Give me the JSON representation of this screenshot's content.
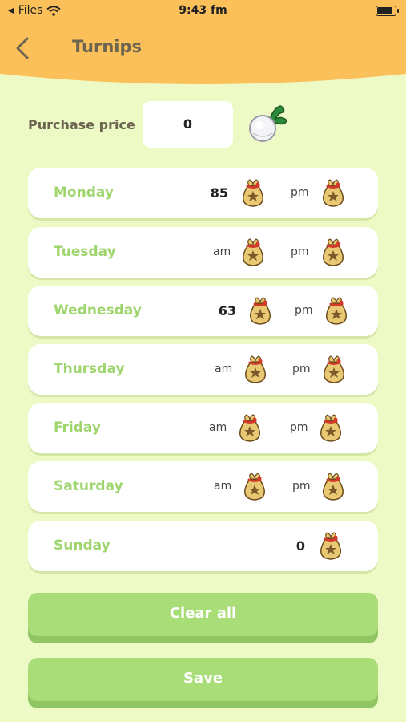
{
  "status": {
    "back_app": "Files",
    "time": "9:43 fm",
    "battery_level": 0.9
  },
  "header": {
    "title": "Turnips"
  },
  "purchase": {
    "label": "Purchase price",
    "value": "0"
  },
  "days": [
    {
      "name": "Monday",
      "am_label": "",
      "am_value": "85",
      "pm_label": "pm",
      "pm_value": ""
    },
    {
      "name": "Tuesday",
      "am_label": "am",
      "am_value": "",
      "pm_label": "pm",
      "pm_value": ""
    },
    {
      "name": "Wednesday",
      "am_label": "",
      "am_value": "63",
      "pm_label": "pm",
      "pm_value": ""
    },
    {
      "name": "Thursday",
      "am_label": "am",
      "am_value": "",
      "pm_label": "pm",
      "pm_value": ""
    },
    {
      "name": "Friday",
      "am_label": "am",
      "am_value": "",
      "pm_label": "pm",
      "pm_value": ""
    },
    {
      "name": "Saturday",
      "am_label": "am",
      "am_value": "",
      "pm_label": "pm",
      "pm_value": ""
    },
    {
      "name": "Sunday",
      "value": "0"
    }
  ],
  "buttons": {
    "clear_label": "Clear all",
    "save_label": "Save"
  },
  "colors": {
    "header": "#fbc05a",
    "background": "#eefac6",
    "day_text": "#9ed56d",
    "button": "#a8dd78"
  },
  "icons": {
    "back": "chevron-left-icon",
    "turnip": "turnip-icon",
    "bag": "bell-bag-icon"
  }
}
